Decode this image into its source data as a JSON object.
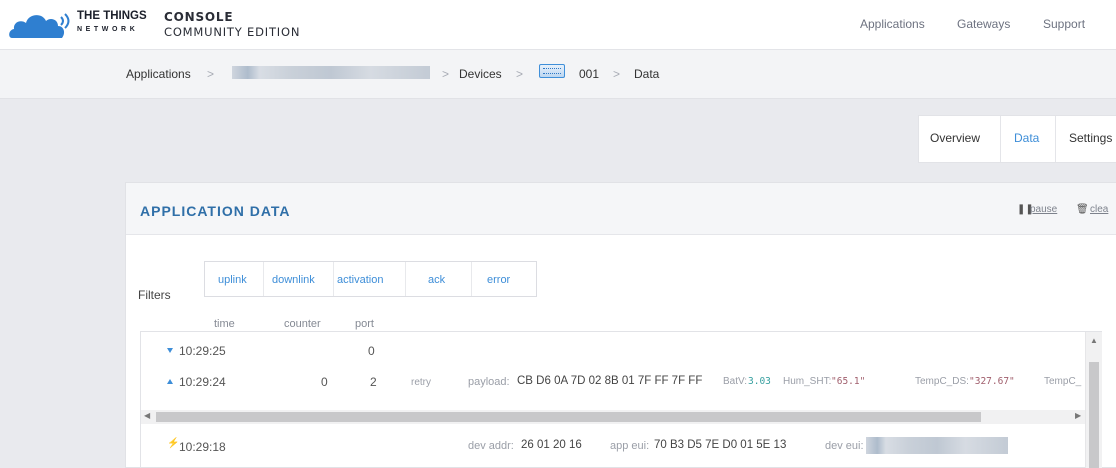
{
  "header": {
    "brand_line1": "THE THINGS",
    "brand_line2": "NETWORK",
    "console": "CONSOLE",
    "edition": "COMMUNITY EDITION",
    "nav": [
      "Applications",
      "Gateways",
      "Support"
    ],
    "logo_icon": "cloud-logo-icon",
    "brand_color": "#2f7fd0"
  },
  "breadcrumb": {
    "applications": "Applications",
    "devices": "Devices",
    "device_id": "001",
    "data": "Data",
    "separator": ">",
    "device_icon": "device-icon"
  },
  "tabs": {
    "overview": "Overview",
    "data": "Data",
    "settings": "Settings",
    "active_color": "#3e8ed8"
  },
  "panel": {
    "title": "APPLICATION DATA",
    "pause": "pause",
    "clear": "clea",
    "pause_icon": "pause-icon",
    "clear_icon": "trash-icon"
  },
  "filters": {
    "label": "Filters",
    "buttons": [
      "uplink",
      "downlink",
      "activation",
      "ack",
      "error"
    ]
  },
  "columns": {
    "time": "time",
    "counter": "counter",
    "port": "port"
  },
  "rows": [
    {
      "direction": "downlink",
      "time": "10:29:25",
      "port": "0"
    },
    {
      "direction": "uplink",
      "time": "10:29:24",
      "counter": "0",
      "port": "2",
      "flag": "retry",
      "payload_label": "payload:",
      "payload": "CB D6 0A 7D 02 8B 01 7F FF 7F FF",
      "fields": [
        {
          "key": "BatV:",
          "value": "3.03"
        },
        {
          "key": "Hum_SHT:",
          "value": "\"65.1\""
        },
        {
          "key": "TempC_DS:",
          "value": "\"327.67\""
        },
        {
          "key": "TempC_",
          "value": ""
        }
      ]
    },
    {
      "direction": "activation",
      "time": "10:29:18",
      "dev_addr_label": "dev addr:",
      "dev_addr": "26 01 20 16",
      "app_eui_label": "app eui:",
      "app_eui": "70 B3 D5 7E D0 01 5E 13",
      "dev_eui_label": "dev eui:"
    }
  ]
}
